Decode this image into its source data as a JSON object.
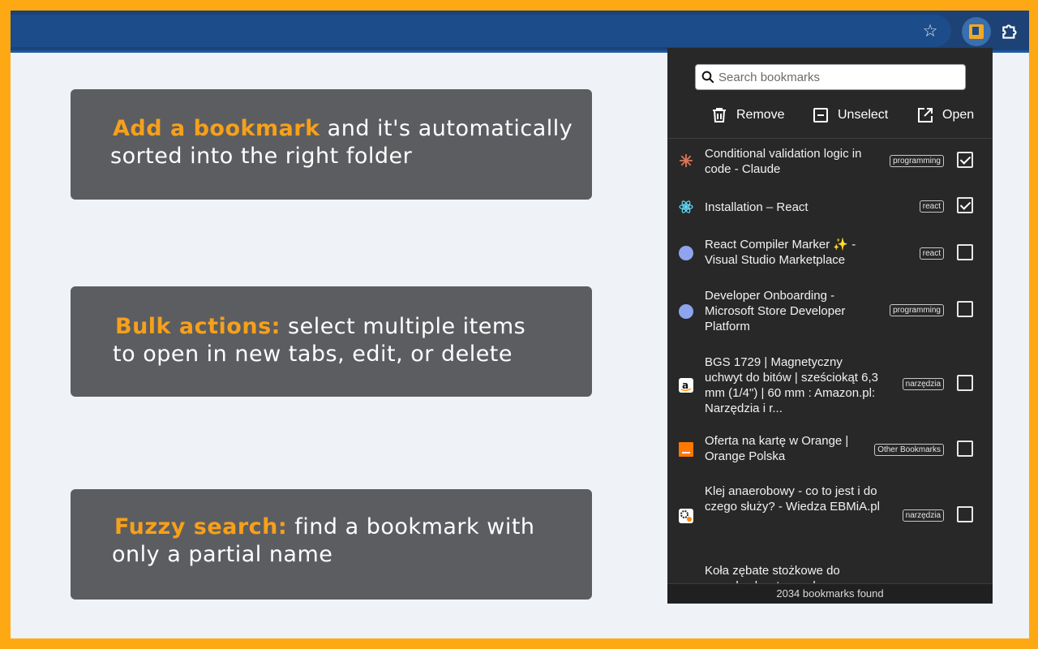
{
  "features": [
    {
      "highlight": "Add a bookmark",
      "rest": " and it's automatically",
      "line2": "sorted into the right folder"
    },
    {
      "highlight": "Bulk actions:",
      "rest": " select multiple items",
      "line2": "to open in new tabs, edit, or delete"
    },
    {
      "highlight": "Fuzzy search:",
      "rest": " find a bookmark with",
      "line2": "only a partial name"
    }
  ],
  "popup": {
    "search_placeholder": "Search bookmarks",
    "actions": {
      "remove": "Remove",
      "unselect": "Unselect",
      "open": "Open"
    },
    "bookmarks": [
      {
        "title": "Conditional validation logic in code - Claude",
        "tag": "programming",
        "checked": true,
        "favicon": "claude-icon"
      },
      {
        "title": "Installation – React",
        "tag": "react",
        "checked": true,
        "favicon": "react-icon"
      },
      {
        "title": "React Compiler Marker ✨ - Visual Studio Marketplace",
        "tag": "react",
        "checked": false,
        "favicon": "globe-icon"
      },
      {
        "title": "Developer Onboarding - Microsoft Store Developer Platform",
        "tag": "programming",
        "checked": false,
        "favicon": "globe-icon"
      },
      {
        "title": "BGS 1729 | Magnetyczny uchwyt do bitów | sześciokąt 6,3 mm (1/4\") | 60 mm : Amazon.pl: Narzędzia i r...",
        "tag": "narzędzia",
        "checked": false,
        "favicon": "amazon-icon"
      },
      {
        "title": "Oferta na kartę w Orange | Orange Polska",
        "tag": "Other Bookmarks",
        "checked": false,
        "favicon": "orange-icon"
      },
      {
        "title": "Klej anaerobowy - co to jest i do czego służy? - Wiedza EBMiA.pl",
        "tag": "narzędzia",
        "checked": false,
        "favicon": "ebmia-icon"
      },
      {
        "title": "Koła zębate stożkowe do napędu chwytacza do",
        "tag": "",
        "checked": false,
        "favicon": ""
      }
    ],
    "footer": "2034 bookmarks found"
  },
  "colors": {
    "frame": "#fea914",
    "highlight": "#f6a01b",
    "card": "#5c5d60",
    "popup": "#282828",
    "toolbar": "#1d4275"
  }
}
